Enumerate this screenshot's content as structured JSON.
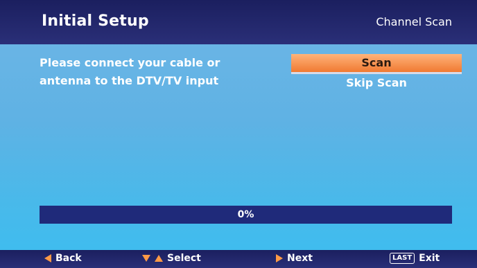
{
  "header": {
    "title": "Initial Setup",
    "section": "Channel Scan"
  },
  "instruction": {
    "line1": "Please connect your cable or",
    "line2": "antenna to the DTV/TV input"
  },
  "menu": {
    "items": [
      {
        "label": "Scan",
        "selected": true
      },
      {
        "label": "Skip Scan",
        "selected": false
      }
    ]
  },
  "progress": {
    "label": "0%",
    "value": 0
  },
  "footer": {
    "back_label": "Back",
    "select_label": "Select",
    "next_label": "Next",
    "last_badge": "LAST",
    "exit_label": "Exit"
  },
  "colors": {
    "header_bg": "#1b1f5f",
    "selected_bg": "#f07a32",
    "progress_bg": "#1f2a7a",
    "arrow": "#ff9a46"
  },
  "icons": {
    "back": "left-triangle-icon",
    "select_down": "down-triangle-icon",
    "select_up": "up-triangle-icon",
    "next": "right-triangle-icon"
  }
}
